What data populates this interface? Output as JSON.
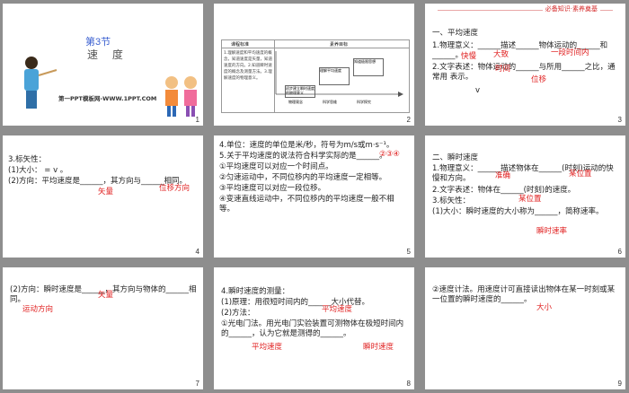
{
  "slides": [
    {
      "number": "1",
      "title": "第3节",
      "subtitle": "速  度",
      "footer": "第一PPT模板网-WWW.1PPT.COM"
    },
    {
      "number": "2",
      "table_header_left": "课程标准",
      "table_header_right": "素养目标",
      "left_text": "1.理解速度和平均速度的概念，知道速度是矢量，知道速度的方向。2.知道瞬时速度的概念及测量方法。3.理解速度的物理意义。",
      "boxes": [
        "初步建立瞬时速度的物理意义",
        "物理观念",
        "理解平均速度",
        "科学思维",
        "知道极限思想",
        "科学探究"
      ]
    },
    {
      "number": "3",
      "section": "一、平均速度",
      "tag": "必备知识·素养奠基",
      "lines": [
        "1.物理意义：______描述______物体运动的______和______。",
        "2.文字表述：物体运动的______与所用______之比，通常用    表示。",
        "    v"
      ],
      "answers": [
        "快慢",
        "大致",
        "一段时间内",
        "位移",
        "时间"
      ]
    },
    {
      "number": "4",
      "lines": [
        "3.标矢性：",
        "(1)大小：    =  v  。",
        "(2)方向：平均速度是______，其方向与______相同。"
      ],
      "answers": [
        "矢量",
        "位移方向"
      ]
    },
    {
      "number": "5",
      "lines": [
        "4.单位：速度的单位是米/秒，符号为m/s或m·s⁻¹。",
        "5.关于平均速度的说法符合科学实际的是______。",
        "①平均速度可以对应一个时间点。",
        "②匀速运动中，不同位移内的平均速度一定相等。",
        "③平均速度可以对应一段位移。",
        "④变速直线运动中，不同位移内的平均速度一般不相等。"
      ],
      "answers": [
        "②③④"
      ]
    },
    {
      "number": "6",
      "section": "二、瞬时速度",
      "lines": [
        "1.物理意义：______描述物体在______(时刻)运动的快慢和方向。",
        "2.文字表述：物体在______(时刻)的速度。",
        "3.标矢性：",
        "(1)大小：瞬时速度的大小称为______，简称速率。"
      ],
      "answers": [
        "准确",
        "某位置",
        "某位置",
        "瞬时速率"
      ]
    },
    {
      "number": "7",
      "lines": [
        "(2)方向：瞬时速度是______，其方向与物体的______相同。"
      ],
      "answers": [
        "矢量",
        "运动方向"
      ]
    },
    {
      "number": "8",
      "lines": [
        "4.瞬时速度的测量：",
        "(1)原理：用很短时间内的______大小代替。",
        "(2)方法：",
        "①光电门法。用光电门实验装置可测物体在极短时间内的______，认为它就是测得的______。"
      ],
      "answers": [
        "平均速度",
        "平均速度",
        "瞬时速度"
      ]
    },
    {
      "number": "9",
      "lines": [
        "②速度计法。用速度计可直接读出物体在某一时刻或某一位置的瞬时速度的______。"
      ],
      "answers": [
        "大小"
      ]
    }
  ]
}
